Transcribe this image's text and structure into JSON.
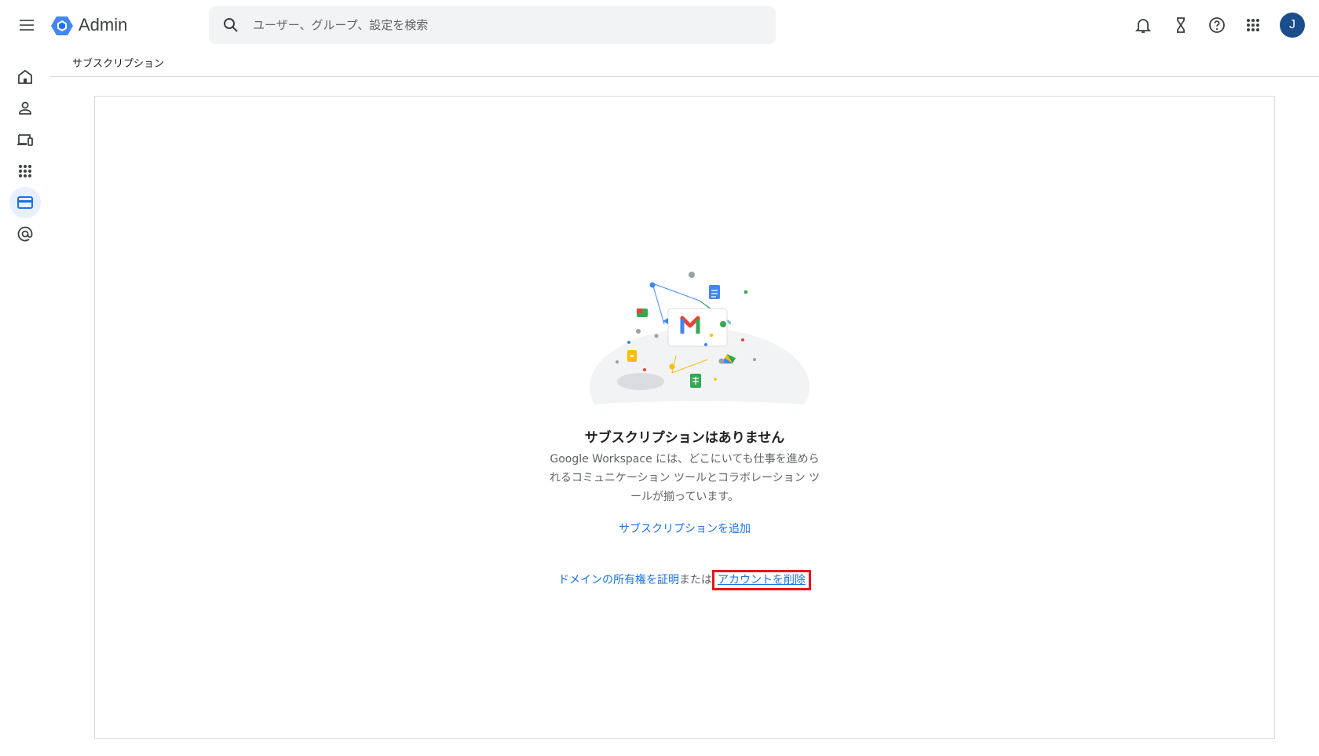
{
  "topbar": {
    "app_title": "Admin",
    "search_placeholder": "ユーザー、グループ、設定を検索",
    "avatar_initial": "J"
  },
  "breadcrumb": "サブスクリプション",
  "empty_state": {
    "title": "サブスクリプションはありません",
    "description": "Google Workspace には、どこにいても仕事を進められるコミュニケーション ツールとコラボレーション ツールが揃っています。",
    "add_link": "サブスクリプションを追加",
    "verify_link": "ドメインの所有権を証明",
    "or_text": "または",
    "delete_link": "アカウントを削除"
  },
  "colors": {
    "accent": "#1a73e8",
    "highlight": "#e8141b",
    "avatar": "#1a4d8c"
  }
}
